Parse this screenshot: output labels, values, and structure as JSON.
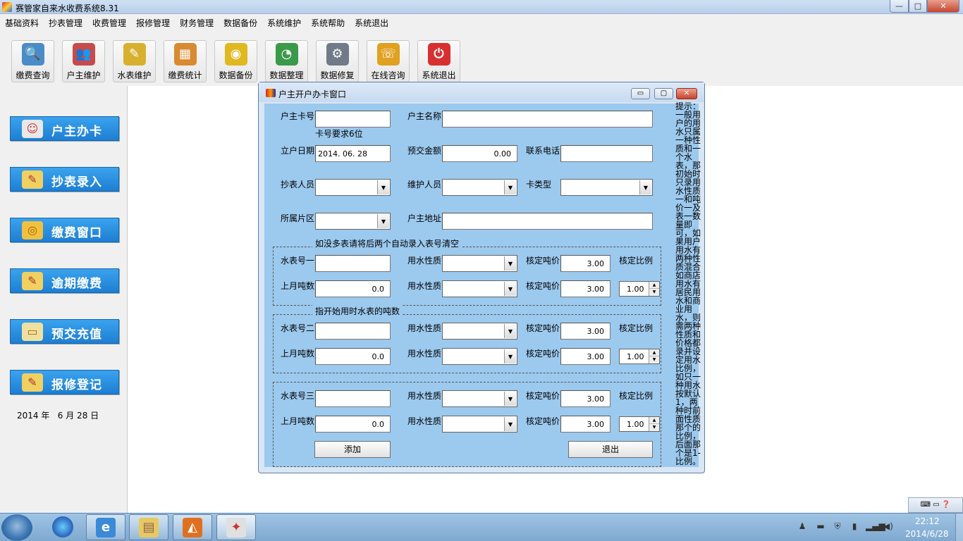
{
  "window": {
    "title": "赛管家自来水收费系统8.31",
    "min": "—",
    "max": "□",
    "close": "✕"
  },
  "menu": [
    "基础资料",
    "抄表管理",
    "收费管理",
    "报修管理",
    "财务管理",
    "数据备份",
    "系统维护",
    "系统帮助",
    "系统退出"
  ],
  "toolbar": [
    {
      "label": "缴费查询",
      "icon": "magnifier-icon",
      "color": "#4a8cc8",
      "glyph": "🔍"
    },
    {
      "label": "户主维护",
      "icon": "users-icon",
      "color": "#c84a4a",
      "glyph": "👥"
    },
    {
      "label": "水表维护",
      "icon": "notepad-icon",
      "color": "#d8b030",
      "glyph": "✎"
    },
    {
      "label": "缴费统计",
      "icon": "box-icon",
      "color": "#d88a30",
      "glyph": "▦"
    },
    {
      "label": "数据备份",
      "icon": "disc-icon",
      "color": "#e0b820",
      "glyph": "◉"
    },
    {
      "label": "数据整理",
      "icon": "pie-chart-icon",
      "color": "#3a9a4a",
      "glyph": "◔"
    },
    {
      "label": "数据修复",
      "icon": "tools-icon",
      "color": "#707a88",
      "glyph": "⚙"
    },
    {
      "label": "在线咨询",
      "icon": "chat-icon",
      "color": "#e0a020",
      "glyph": "☏"
    },
    {
      "label": "系统退出",
      "icon": "power-icon",
      "color": "#d83030",
      "glyph": "⏻"
    }
  ],
  "sidebar": [
    {
      "label": "户主办卡",
      "icon": "person-icon",
      "color": "#e8e8e8",
      "glyph": "☺"
    },
    {
      "label": "抄表录入",
      "icon": "notepad-icon",
      "color": "#f0d060",
      "glyph": "✎"
    },
    {
      "label": "缴费窗口",
      "icon": "coins-icon",
      "color": "#f0c040",
      "glyph": "◎"
    },
    {
      "label": "逾期缴费",
      "icon": "notepad-icon",
      "color": "#f0d060",
      "glyph": "✎"
    },
    {
      "label": "预交充值",
      "icon": "card-icon",
      "color": "#f0e0a0",
      "glyph": "▭"
    },
    {
      "label": "报修登记",
      "icon": "notepad-icon",
      "color": "#f0d060",
      "glyph": "✎"
    }
  ],
  "date_text": "2014 年   6 月 28 日",
  "dialog": {
    "title": "户主开户办卡窗口",
    "min": "▭",
    "max": "▢",
    "close": "✕",
    "card_no_label": "户主卡号",
    "card_no": "",
    "card_hint": "卡号要求6位",
    "name_label": "户主名称",
    "name": "",
    "open_date_label": "立户日期",
    "open_date": "2014. 06. 28",
    "prepay_label": "预交金额",
    "prepay": "0.00",
    "phone_label": "联系电话",
    "phone": "",
    "reader_label": "抄表人员",
    "reader": "",
    "maint_label": "维护人员",
    "maint": "",
    "cardtype_label": "卡类型",
    "cardtype": "",
    "area_label": "所属片区",
    "area": "",
    "address_label": "户主地址",
    "address": "",
    "group1_title": "如没多表请将后两个自动录入表号清空",
    "group2_title": "指开始用时水表的吨数",
    "meters": [
      {
        "no_label": "水表号一",
        "no": "",
        "nature_label": "用水性质",
        "price_label": "核定吨价",
        "price1": "3.00",
        "ratio_label": "核定比例",
        "last_label": "上月吨数",
        "last": "0.0",
        "nature2_label": "用水性质",
        "price2_label": "核定吨价",
        "price2": "3.00",
        "ratio": "1.00"
      },
      {
        "no_label": "水表号二",
        "no": "",
        "nature_label": "用水性质",
        "price_label": "核定吨价",
        "price1": "3.00",
        "ratio_label": "核定比例",
        "last_label": "上月吨数",
        "last": "0.0",
        "nature2_label": "用水性质",
        "price2_label": "核定吨价",
        "price2": "3.00",
        "ratio": "1.00"
      },
      {
        "no_label": "水表号三",
        "no": "",
        "nature_label": "用水性质",
        "price_label": "核定吨价",
        "price1": "3.00",
        "ratio_label": "核定比例",
        "last_label": "上月吨数",
        "last": "0.0",
        "nature2_label": "用水性质",
        "price2_label": "核定吨价",
        "price2": "3.00",
        "ratio": "1.00"
      }
    ],
    "add_label": "添加",
    "exit_label": "退出",
    "tip": "提示：一般用户的用水只属一种性质和一个水表，那初始时只录用水性质一和吨价一及表一数量即可，如果用户用水有两种性质混合如商店用水有居民用水和商业用水，则需两种性质和价格都录并设定用水比例，如只一种用水按默认1，两种时前面性质那个的比例，后面那个是1-比例。"
  },
  "taskbar": {
    "apps": [
      {
        "name": "ie-icon",
        "color": "#3a8ad8",
        "glyph": "e"
      },
      {
        "name": "explorer-icon",
        "color": "#e8c860",
        "glyph": "▤"
      },
      {
        "name": "fox-icon",
        "color": "#e07020",
        "glyph": "◭"
      },
      {
        "name": "app-icon",
        "color": "#e0e0e0",
        "glyph": "✦"
      }
    ],
    "time": "22:12",
    "date": "2014/6/28"
  }
}
